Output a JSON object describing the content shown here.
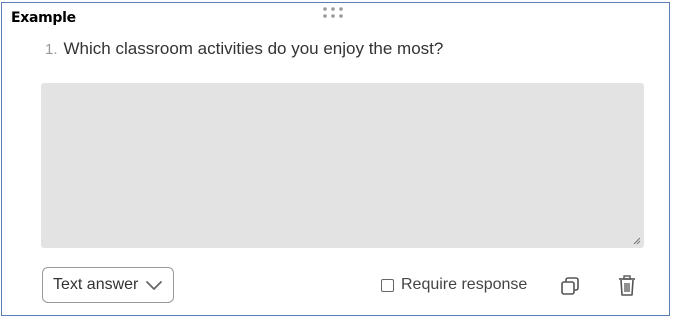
{
  "card": {
    "label": "Example"
  },
  "question": {
    "number": "1.",
    "text": "Which classroom activities do you enjoy the most?"
  },
  "answer_area": {
    "value": ""
  },
  "footer": {
    "answer_type": "Text answer",
    "require_label": "Require response",
    "require_checked": false
  },
  "icons": {
    "drag": "drag-handle-icon",
    "chevron": "chevron-down-icon",
    "copy": "copy-icon",
    "delete": "trash-icon"
  },
  "colors": {
    "card_border": "#5b7fb5",
    "answer_bg": "#e3e3e3",
    "text": "#333333",
    "muted": "#9a9a9a"
  }
}
